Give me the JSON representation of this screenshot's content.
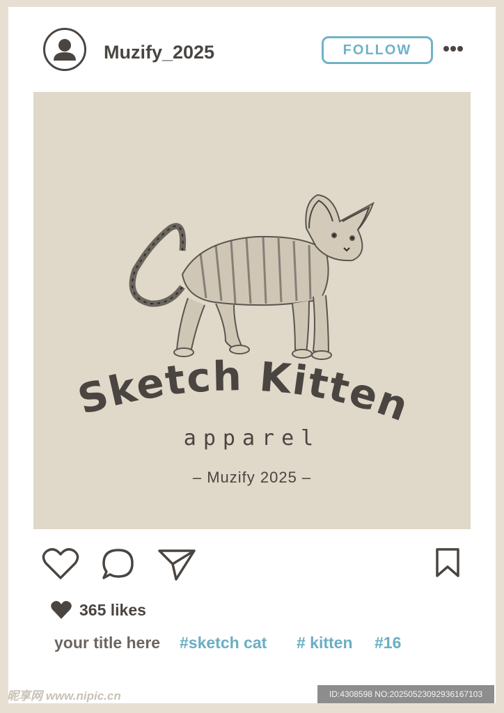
{
  "post": {
    "username": "Muzify_2025",
    "follow_label": "FOLLOW",
    "likes": "365 likes",
    "caption": "your title here",
    "hashtags": [
      "#sketch cat",
      "# kitten",
      "#16"
    ]
  },
  "image": {
    "brand_title": "Sketch Kitten",
    "brand_sub": "apparel",
    "brand_credit": "– Muzify 2025 –"
  },
  "watermark": {
    "site": "昵享网 www.nipic.cn",
    "id_text": "ID:4308598 NO:20250523092936167103"
  },
  "colors": {
    "frame": "#e7e0d2",
    "image_bg": "#e0d8c8",
    "accent": "#70b2c8",
    "text": "#4a4541"
  },
  "icons": [
    "user-avatar-icon",
    "more-dots-icon",
    "heart-icon",
    "comment-icon",
    "send-icon",
    "bookmark-icon",
    "small-heart-icon",
    "cat-sketch-illustration"
  ]
}
